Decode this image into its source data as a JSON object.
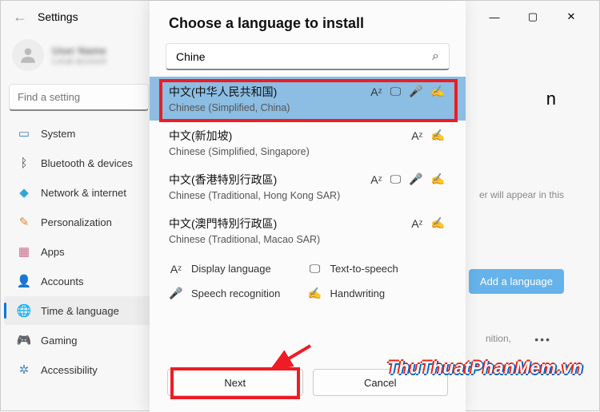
{
  "window": {
    "title": "Settings",
    "controls": {
      "min": "—",
      "max": "▢",
      "close": "✕"
    }
  },
  "sidebar": {
    "profile": {
      "name": "User Name",
      "sub": "Local account"
    },
    "search_placeholder": "Find a setting",
    "items": [
      {
        "label": "System",
        "color": "#3a7fc4",
        "glyph": "▭"
      },
      {
        "label": "Bluetooth & devices",
        "color": "#4a4a4a",
        "glyph": "ᛒ"
      },
      {
        "label": "Network & internet",
        "color": "#2fa8d8",
        "glyph": "◆"
      },
      {
        "label": "Personalization",
        "color": "#e08a3a",
        "glyph": "✎"
      },
      {
        "label": "Apps",
        "color": "#d06a8a",
        "glyph": "▦"
      },
      {
        "label": "Accounts",
        "color": "#6aa0c4",
        "glyph": "👤"
      },
      {
        "label": "Time & language",
        "color": "#4aa87a",
        "glyph": "🌐"
      },
      {
        "label": "Gaming",
        "color": "#7aa84a",
        "glyph": "🎮"
      },
      {
        "label": "Accessibility",
        "color": "#4a8ac4",
        "glyph": "✲"
      }
    ],
    "active_index": 6
  },
  "content": {
    "hint_fragment": "er will appear in this",
    "add_language": "Add a language",
    "nition_fragment": "nition,"
  },
  "modal": {
    "title": "Choose a language to install",
    "search_value": "Chine",
    "selected_index": 0,
    "languages": [
      {
        "native": "中文(中华人民共和国)",
        "english": "Chinese (Simplified, China)",
        "icons": [
          "display",
          "tts",
          "speech",
          "hand"
        ]
      },
      {
        "native": "中文(新加坡)",
        "english": "Chinese (Simplified, Singapore)",
        "icons": [
          "display",
          "hand"
        ]
      },
      {
        "native": "中文(香港特別行政區)",
        "english": "Chinese (Traditional, Hong Kong SAR)",
        "icons": [
          "display",
          "tts",
          "speech",
          "hand"
        ]
      },
      {
        "native": "中文(澳門特別行政區)",
        "english": "Chinese (Traditional, Macao SAR)",
        "icons": [
          "display",
          "hand"
        ]
      }
    ],
    "legend": {
      "display": "Display language",
      "tts": "Text-to-speech",
      "speech": "Speech recognition",
      "hand": "Handwriting"
    },
    "buttons": {
      "next": "Next",
      "cancel": "Cancel"
    }
  },
  "watermark": "ThuThuatPhanMem.vn",
  "icon_glyphs": {
    "display": "Aᶻ",
    "tts": "🖵",
    "speech": "🎤",
    "hand": "✍"
  }
}
